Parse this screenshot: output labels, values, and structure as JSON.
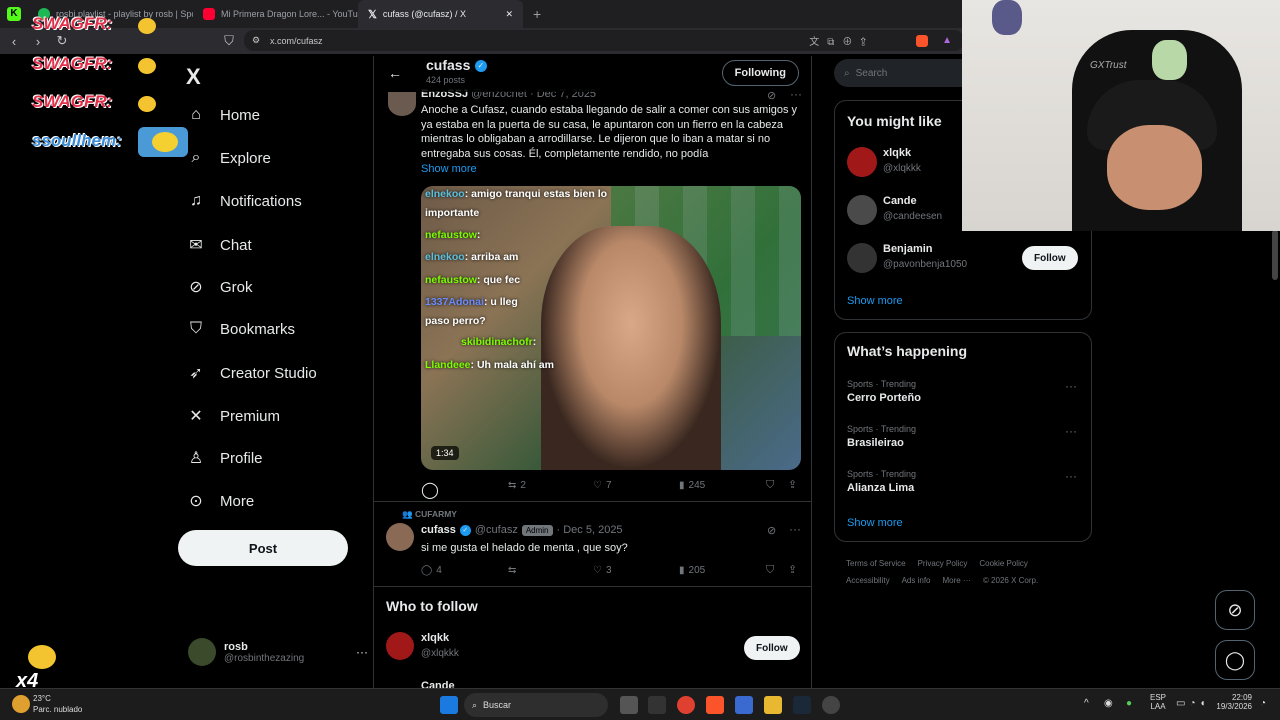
{
  "browser": {
    "tabs": [
      {
        "label": "rosbi playlist - playlist by rosb | Spoti",
        "color": "#1db954"
      },
      {
        "label": "Mi Primera Dragon Lore... - YouTube",
        "color": "#ff0033"
      },
      {
        "label": "cufass (@cufasz) / X",
        "color": "#ffffff"
      }
    ],
    "url": "x.com/cufasz",
    "new_tab": "+",
    "close": "✕"
  },
  "stream_overlay": {
    "chat": [
      {
        "user": "SWAGFR:"
      },
      {
        "user": "SWAGFR:"
      },
      {
        "user": "SWAGFR:"
      },
      {
        "user": "ssoullhem:"
      }
    ],
    "multiplier": "x4"
  },
  "leftnav": {
    "logo": "X",
    "items": [
      {
        "label": "Home",
        "icon": "home-icon",
        "glyph": "⌂"
      },
      {
        "label": "Explore",
        "icon": "search-icon",
        "glyph": "⌕"
      },
      {
        "label": "Notifications",
        "icon": "bell-icon",
        "glyph": "🔔"
      },
      {
        "label": "Chat",
        "icon": "mail-icon",
        "glyph": "✉"
      },
      {
        "label": "Grok",
        "icon": "grok-icon",
        "glyph": "⊘"
      },
      {
        "label": "Bookmarks",
        "icon": "bookmark-icon",
        "glyph": "⛉"
      },
      {
        "label": "Creator Studio",
        "icon": "rocket-icon",
        "glyph": "🚀"
      },
      {
        "label": "Premium",
        "icon": "x-icon",
        "glyph": "𝕏"
      },
      {
        "label": "Profile",
        "icon": "person-icon",
        "glyph": "👤"
      },
      {
        "label": "More",
        "icon": "more-icon",
        "glyph": "⋯"
      }
    ],
    "post_label": "Post",
    "user": {
      "name": "rosb",
      "handle": "@rosbinthezazing"
    }
  },
  "main": {
    "header": {
      "name": "cufass",
      "posts": "424 posts",
      "following_label": "Following"
    },
    "tweet1": {
      "author": "EnzoSSJ",
      "handle": "@enzocnet",
      "date": "· Dec 7, 2025",
      "text": "Anoche a Cufasz, cuando estaba llegando de salir a comer con sus amigos y ya estaba en la puerta de su casa, le apuntaron con un fierro en la cabeza mientras lo obligaban a arrodillarse. Le dijeron que lo iban a matar si no entregaba sus cosas. Él, completamente rendido, no podía",
      "show_more": "Show more",
      "video_time": "1:34",
      "chat": [
        {
          "user": "elnekoo",
          "msg": ": amigo tranqui estas bien lo"
        },
        {
          "user": "",
          "msg": "importante"
        },
        {
          "user": "nefaustow",
          "msg": ":"
        },
        {
          "user": "elnekoo",
          "msg": ": arriba am"
        },
        {
          "user": "nefaustow",
          "msg": ": que fec"
        },
        {
          "user": "1337Adonai",
          "msg": ": u lleg"
        },
        {
          "user": "",
          "msg": "paso perro?"
        },
        {
          "user": "skibidinachofr",
          "msg": ":"
        },
        {
          "user": "Llandeee",
          "msg": ": Uh mala ahí am"
        }
      ],
      "replies": "",
      "retweets": "2",
      "likes": "7",
      "views": "245"
    },
    "tweet2": {
      "community": "CUFARMY",
      "author": "cufass",
      "handle": "@cufasz",
      "badge": "Admin",
      "date": "· Dec 5, 2025",
      "text": "si me gusta el helado de menta , que soy?",
      "replies": "4",
      "retweets": "",
      "likes": "3",
      "views": "205"
    },
    "who_to_follow": {
      "title": "Who to follow",
      "user": {
        "name": "xlqkk",
        "handle": "@xlqkkk"
      },
      "next_user": "Cande",
      "follow_label": "Follow"
    }
  },
  "right": {
    "search_placeholder": "Search",
    "you_might_like": {
      "title": "You might like",
      "users": [
        {
          "name": "xlqkk",
          "handle": "@xlqkkk"
        },
        {
          "name": "Cande",
          "handle": "@candeesen"
        },
        {
          "name": "Benjamin",
          "handle": "@pavonbenja1050"
        }
      ],
      "follow_label": "Follow",
      "show_more": "Show more"
    },
    "whats_happening": {
      "title": "What’s happening",
      "trends": [
        {
          "cat": "Sports · Trending",
          "name": "Cerro Porteño"
        },
        {
          "cat": "Sports · Trending",
          "name": "Brasileirao"
        },
        {
          "cat": "Sports · Trending",
          "name": "Alianza Lima"
        }
      ],
      "show_more": "Show more"
    },
    "footer": {
      "line1": [
        "Terms of Service",
        "Privacy Policy",
        "Cookie Policy"
      ],
      "line2": [
        "Accessibility",
        "Ads info",
        "More ···",
        "© 2026 X Corp."
      ]
    }
  },
  "webcam": {
    "cap_text": "GXTrust"
  },
  "taskbar": {
    "weather_temp": "23°C",
    "weather_desc": "Parc. nublado",
    "search": "Buscar",
    "lang1": "ESP",
    "lang2": "LAA",
    "time": "22:09",
    "date": "19/3/2026"
  }
}
